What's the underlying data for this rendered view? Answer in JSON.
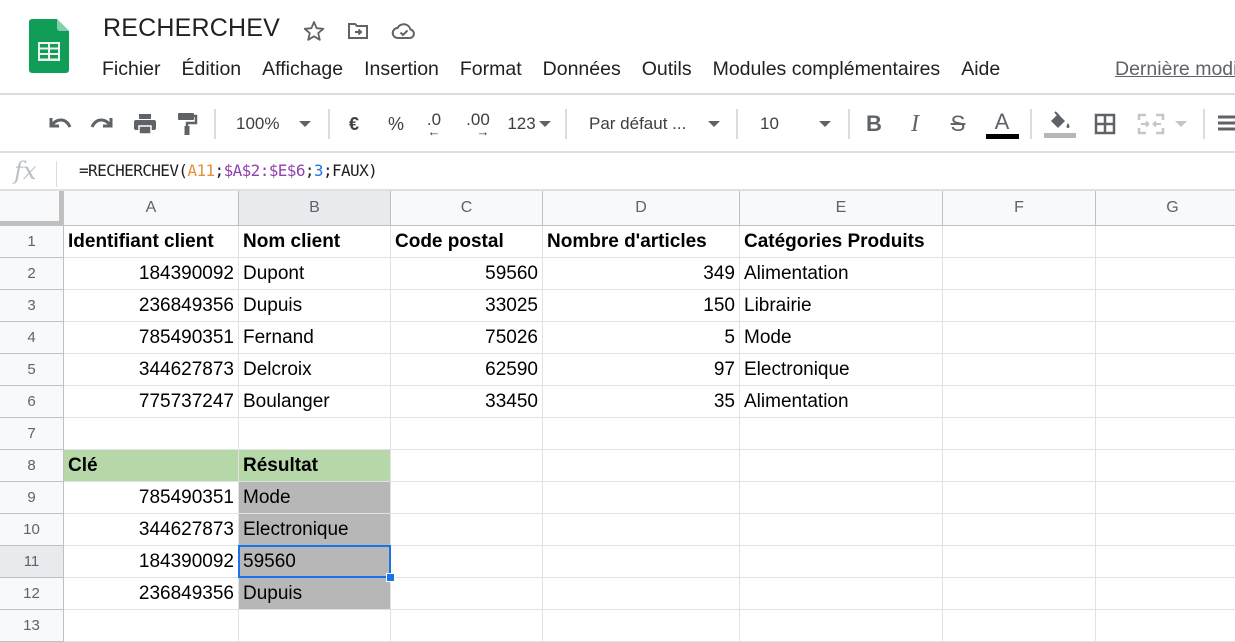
{
  "app": {
    "doc_title": "RECHERCHEV",
    "brand_color": "#0f9d58",
    "menu": [
      "Fichier",
      "Édition",
      "Affichage",
      "Insertion",
      "Format",
      "Données",
      "Outils",
      "Modules complémentaires",
      "Aide"
    ],
    "last_edit_link": "Dernière modification"
  },
  "toolbar": {
    "zoom": "100%",
    "currency": "€",
    "percent": "%",
    "decrease_decimals": ".0",
    "increase_decimals": ".00",
    "number_format": "123",
    "font": "Par défaut ...",
    "font_size": "10",
    "text_color": "#000000",
    "fill_color": "#b7b7b7"
  },
  "formula_bar": {
    "fx_label": "fx",
    "formula_parts": {
      "prefix": "=RECHERCHEV(",
      "ref1": "A11",
      "sep1": ";",
      "ref2": "$A$2:$E$6",
      "sep2": ";",
      "index": "3",
      "suffix": ";FAUX)"
    }
  },
  "sheet": {
    "columns": [
      "A",
      "B",
      "C",
      "D",
      "E",
      "F",
      "G"
    ],
    "rows": [
      "1",
      "2",
      "3",
      "4",
      "5",
      "6",
      "7",
      "8",
      "9",
      "10",
      "11",
      "12",
      "13"
    ],
    "selected_cell": "B11",
    "header_row": [
      "Identifiant client",
      "Nom client",
      "Code postal",
      "Nombre d'articles",
      "Catégories Produits"
    ],
    "data": [
      [
        "184390092",
        "Dupont",
        "59560",
        "349",
        "Alimentation"
      ],
      [
        "236849356",
        "Dupuis",
        "33025",
        "150",
        "Librairie"
      ],
      [
        "785490351",
        "Fernand",
        "75026",
        "5",
        "Mode"
      ],
      [
        "344627873",
        "Delcroix",
        "62590",
        "97",
        "Electronique"
      ],
      [
        "775737247",
        "Boulanger",
        "33450",
        "35",
        "Alimentation"
      ]
    ],
    "lookup_header": [
      "Clé",
      "Résultat"
    ],
    "lookup": [
      [
        "785490351",
        "Mode"
      ],
      [
        "344627873",
        "Electronique"
      ],
      [
        "184390092",
        "59560"
      ],
      [
        "236849356",
        "Dupuis"
      ]
    ]
  }
}
